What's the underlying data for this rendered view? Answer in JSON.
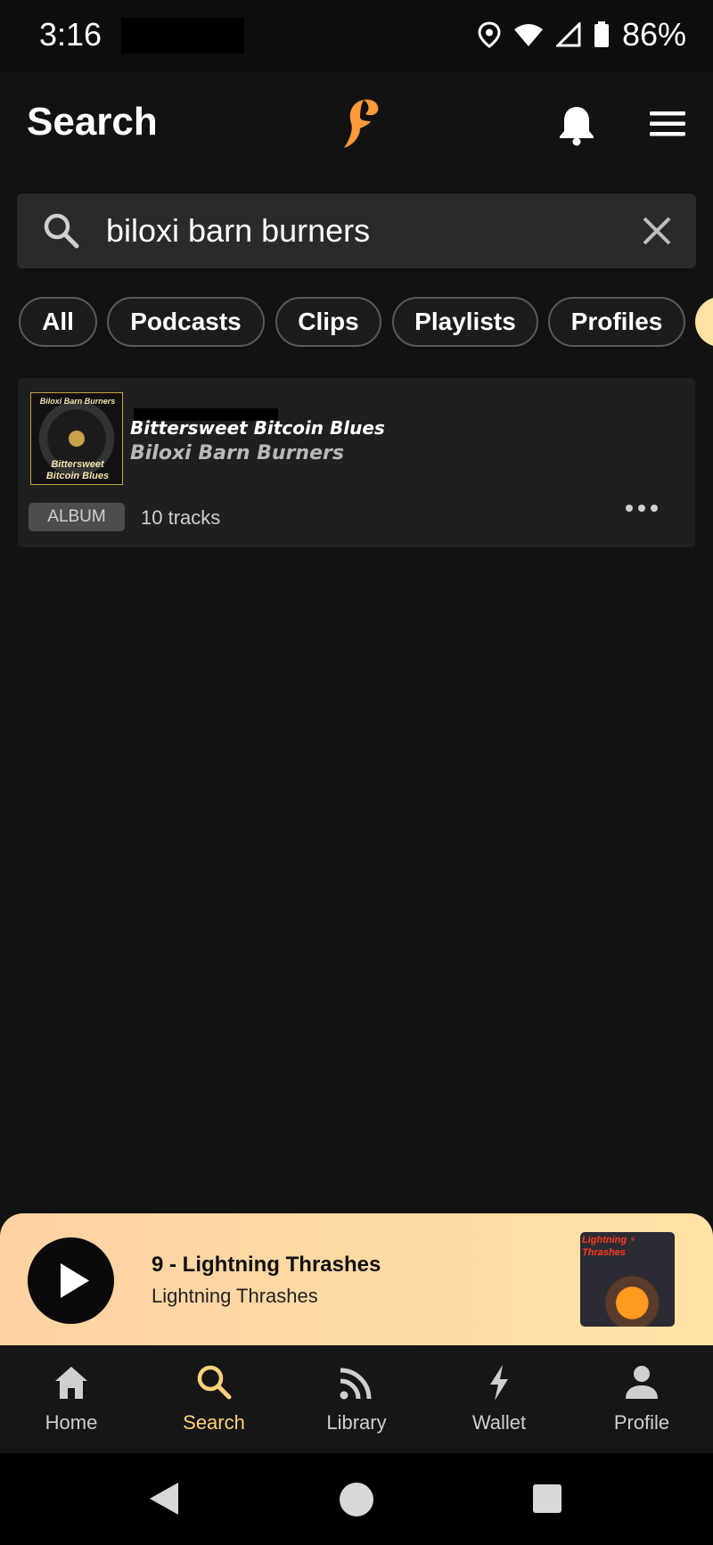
{
  "status_bar": {
    "time": "3:16",
    "battery": "86%",
    "icons": [
      "location-icon",
      "wifi-icon",
      "signal-icon",
      "battery-icon"
    ]
  },
  "header": {
    "title": "Search",
    "logo": "fountain-logo",
    "accent_color": "#ff9a3c"
  },
  "search": {
    "value": "biloxi barn burners"
  },
  "filters": [
    {
      "label": "All"
    },
    {
      "label": "Podcasts"
    },
    {
      "label": "Clips"
    },
    {
      "label": "Playlists"
    },
    {
      "label": "Profiles"
    }
  ],
  "results": [
    {
      "title": "Bittersweet Bitcoin Blues",
      "artist": "Biloxi Barn Burners",
      "art_text_top": "Biloxi Barn Burners",
      "art_text_bottom": "Bittersweet Bitcoin Blues",
      "badge": "ALBUM",
      "meta": "10 tracks"
    }
  ],
  "now_playing": {
    "title": "9 - Lightning Thrashes",
    "artist": "Lightning Thrashes",
    "art_text": "Lightning ⚡ Thrashes",
    "background_colors": [
      "#ffd2a3",
      "#ffe2a6"
    ]
  },
  "bottom_nav": [
    {
      "label": "Home",
      "icon": "home-icon",
      "active": false
    },
    {
      "label": "Search",
      "icon": "search-icon",
      "active": true
    },
    {
      "label": "Library",
      "icon": "library-icon",
      "active": false
    },
    {
      "label": "Wallet",
      "icon": "lightning-icon",
      "active": false
    },
    {
      "label": "Profile",
      "icon": "profile-icon",
      "active": false
    }
  ],
  "nav_active_color": "#ffd27a"
}
